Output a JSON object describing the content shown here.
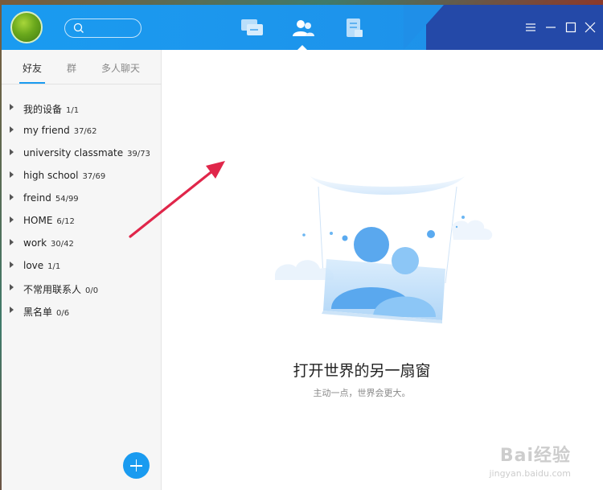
{
  "header": {
    "nav": [
      {
        "name": "messages",
        "icon": "chat-bubble-icon"
      },
      {
        "name": "contacts",
        "icon": "contacts-icon",
        "active": true
      },
      {
        "name": "news",
        "icon": "document-icon"
      }
    ],
    "window_controls": [
      "menu-icon",
      "minimize-icon",
      "maximize-icon",
      "close-icon"
    ]
  },
  "sidebar": {
    "tabs": [
      {
        "label": "好友",
        "active": true
      },
      {
        "label": "群"
      },
      {
        "label": "多人聊天"
      }
    ],
    "groups": [
      {
        "name": "我的设备",
        "count": "1/1"
      },
      {
        "name": "my friend",
        "count": "37/62"
      },
      {
        "name": "university classmate",
        "count": "39/73"
      },
      {
        "name": "high school",
        "count": "37/69"
      },
      {
        "name": "freind",
        "count": "54/99"
      },
      {
        "name": "HOME",
        "count": "6/12"
      },
      {
        "name": "work",
        "count": "30/42"
      },
      {
        "name": "love",
        "count": "1/1"
      },
      {
        "name": "不常用联系人",
        "count": "0/0"
      },
      {
        "name": "黑名单",
        "count": "0/6"
      }
    ]
  },
  "main": {
    "title": "打开世界的另一扇窗",
    "subtitle": "主动一点，世界会更大。"
  },
  "watermark": {
    "brand": "Bai经验",
    "url": "jingyan.baidu.com"
  },
  "colors": {
    "accent": "#1a9bf0",
    "annotation_arrow": "#e0264a"
  }
}
